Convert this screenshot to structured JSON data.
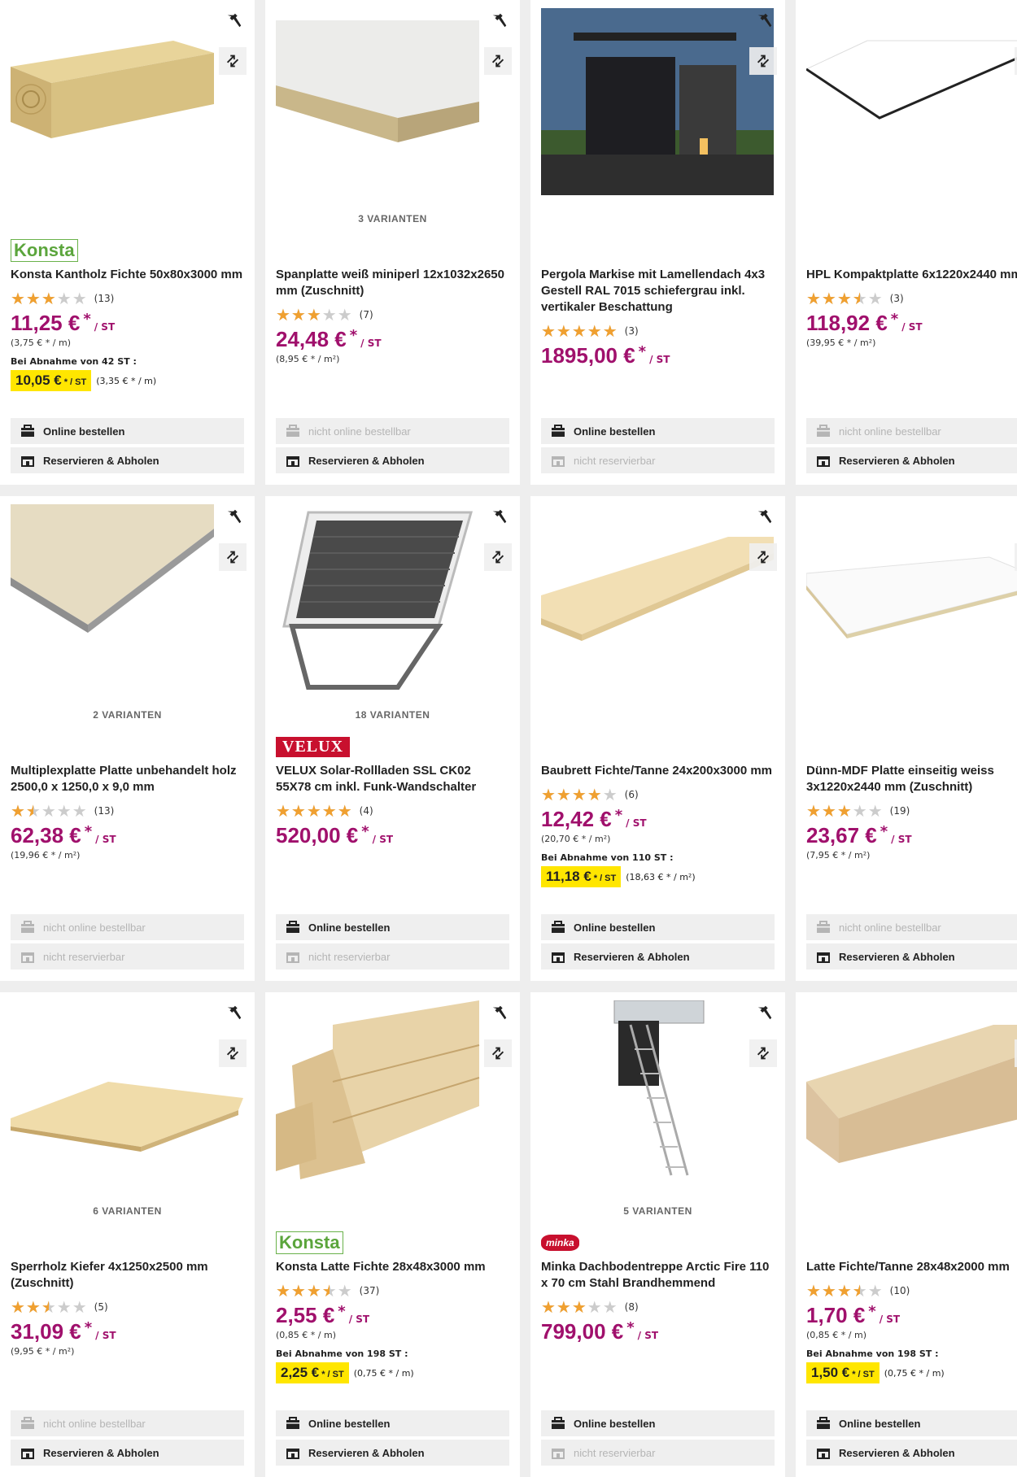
{
  "colors": {
    "price": "#a0106c",
    "highlight": "#ffe600",
    "star": "#f0a030",
    "star_empty": "#cccccc"
  },
  "icons": {
    "tool": "hammer-icon",
    "compare": "compare-arrows-icon",
    "online": "cart-icon",
    "reserve": "store-icon"
  },
  "products": [
    {
      "brand": "Konsta",
      "variants": "",
      "title": "Konsta Kantholz Fichte 50x80x3000 mm",
      "rating": 3.0,
      "reviews": "(13)",
      "price": "11,25 €",
      "unit": "/ ST",
      "unit_price": "(3,75 € * / m)",
      "bulk_label": "Bei Abnahme von 42 ST :",
      "bulk_price": "10,05 €",
      "bulk_unit": "/ ST",
      "bulk_unit_price": "(3,35 € * / m)",
      "online": "Online bestellen",
      "online_enabled": true,
      "reserve": "Reservieren & Abholen",
      "reserve_enabled": true
    },
    {
      "brand": "",
      "variants": "3 VARIANTEN",
      "title": "Spanplatte weiß miniperl 12x1032x2650 mm (Zuschnitt)",
      "rating": 3.0,
      "reviews": "(7)",
      "price": "24,48 €",
      "unit": "/ ST",
      "unit_price": "(8,95 € * / m²)",
      "bulk_label": "",
      "bulk_price": "",
      "bulk_unit": "",
      "bulk_unit_price": "",
      "online": "nicht online bestellbar",
      "online_enabled": false,
      "reserve": "Reservieren & Abholen",
      "reserve_enabled": true
    },
    {
      "brand": "",
      "variants": "",
      "title": "Pergola Markise mit Lamellendach 4x3 Gestell RAL 7015 schiefergrau inkl. vertikaler Beschattung",
      "rating": 5.0,
      "reviews": "(3)",
      "price": "1895,00 €",
      "unit": "/ ST",
      "unit_price": "",
      "bulk_label": "",
      "bulk_price": "",
      "bulk_unit": "",
      "bulk_unit_price": "",
      "online": "Online bestellen",
      "online_enabled": true,
      "reserve": "nicht reservierbar",
      "reserve_enabled": false
    },
    {
      "brand": "",
      "variants": "",
      "title": "HPL Kompaktplatte 6x1220x2440 mm",
      "rating": 3.5,
      "reviews": "(3)",
      "price": "118,92 €",
      "unit": "/ ST",
      "unit_price": "(39,95 € * / m²)",
      "bulk_label": "",
      "bulk_price": "",
      "bulk_unit": "",
      "bulk_unit_price": "",
      "online": "nicht online bestellbar",
      "online_enabled": false,
      "reserve": "Reservieren & Abholen",
      "reserve_enabled": true
    },
    {
      "brand": "",
      "variants": "2 VARIANTEN",
      "title": "Multiplexplatte Platte unbehandelt holz 2500,0 x 1250,0 x 9,0 mm",
      "rating": 1.5,
      "reviews": "(13)",
      "price": "62,38 €",
      "unit": "/ ST",
      "unit_price": "(19,96 € * / m²)",
      "bulk_label": "",
      "bulk_price": "",
      "bulk_unit": "",
      "bulk_unit_price": "",
      "online": "nicht online bestellbar",
      "online_enabled": false,
      "reserve": "nicht reservierbar",
      "reserve_enabled": false
    },
    {
      "brand": "VELUX",
      "variants": "18 VARIANTEN",
      "title": "VELUX Solar-Rollladen SSL CK02 55X78 cm inkl. Funk-Wandschalter",
      "rating": 5.0,
      "reviews": "(4)",
      "price": "520,00 €",
      "unit": "/ ST",
      "unit_price": "",
      "bulk_label": "",
      "bulk_price": "",
      "bulk_unit": "",
      "bulk_unit_price": "",
      "online": "Online bestellen",
      "online_enabled": true,
      "reserve": "nicht reservierbar",
      "reserve_enabled": false
    },
    {
      "brand": "",
      "variants": "",
      "title": "Baubrett Fichte/Tanne 24x200x3000 mm",
      "rating": 4.0,
      "reviews": "(6)",
      "price": "12,42 €",
      "unit": "/ ST",
      "unit_price": "(20,70 € * / m²)",
      "bulk_label": "Bei Abnahme von 110 ST :",
      "bulk_price": "11,18 €",
      "bulk_unit": "/ ST",
      "bulk_unit_price": "(18,63 € * / m²)",
      "online": "Online bestellen",
      "online_enabled": true,
      "reserve": "Reservieren & Abholen",
      "reserve_enabled": true
    },
    {
      "brand": "",
      "variants": "",
      "title": "Dünn-MDF Platte einseitig weiss 3x1220x2440 mm (Zuschnitt)",
      "rating": 3.0,
      "reviews": "(19)",
      "price": "23,67 €",
      "unit": "/ ST",
      "unit_price": "(7,95 € * / m²)",
      "bulk_label": "",
      "bulk_price": "",
      "bulk_unit": "",
      "bulk_unit_price": "",
      "online": "nicht online bestellbar",
      "online_enabled": false,
      "reserve": "Reservieren & Abholen",
      "reserve_enabled": true
    },
    {
      "brand": "",
      "variants": "6 VARIANTEN",
      "title": "Sperrholz Kiefer 4x1250x2500 mm (Zuschnitt)",
      "rating": 2.5,
      "reviews": "(5)",
      "price": "31,09 €",
      "unit": "/ ST",
      "unit_price": "(9,95 € * / m²)",
      "bulk_label": "",
      "bulk_price": "",
      "bulk_unit": "",
      "bulk_unit_price": "",
      "online": "nicht online bestellbar",
      "online_enabled": false,
      "reserve": "Reservieren & Abholen",
      "reserve_enabled": true
    },
    {
      "brand": "Konsta",
      "variants": "",
      "title": "Konsta Latte Fichte 28x48x3000 mm",
      "rating": 3.5,
      "reviews": "(37)",
      "price": "2,55 €",
      "unit": "/ ST",
      "unit_price": "(0,85 € * / m)",
      "bulk_label": "Bei Abnahme von 198 ST :",
      "bulk_price": "2,25 €",
      "bulk_unit": "/ ST",
      "bulk_unit_price": "(0,75 € * / m)",
      "online": "Online bestellen",
      "online_enabled": true,
      "reserve": "Reservieren & Abholen",
      "reserve_enabled": true
    },
    {
      "brand": "minka",
      "variants": "5 VARIANTEN",
      "title": "Minka Dachbodentreppe Arctic Fire 110 x 70 cm Stahl Brandhemmend",
      "rating": 3.0,
      "reviews": "(8)",
      "price": "799,00 €",
      "unit": "/ ST",
      "unit_price": "",
      "bulk_label": "",
      "bulk_price": "",
      "bulk_unit": "",
      "bulk_unit_price": "",
      "online": "Online bestellen",
      "online_enabled": true,
      "reserve": "nicht reservierbar",
      "reserve_enabled": false
    },
    {
      "brand": "",
      "variants": "",
      "title": "Latte Fichte/Tanne 28x48x2000 mm",
      "rating": 3.5,
      "reviews": "(10)",
      "price": "1,70 €",
      "unit": "/ ST",
      "unit_price": "(0,85 € * / m)",
      "bulk_label": "Bei Abnahme von 198 ST :",
      "bulk_price": "1,50 €",
      "bulk_unit": "/ ST",
      "bulk_unit_price": "(0,75 € * / m)",
      "online": "Online bestellen",
      "online_enabled": true,
      "reserve": "Reservieren & Abholen",
      "reserve_enabled": true
    }
  ]
}
